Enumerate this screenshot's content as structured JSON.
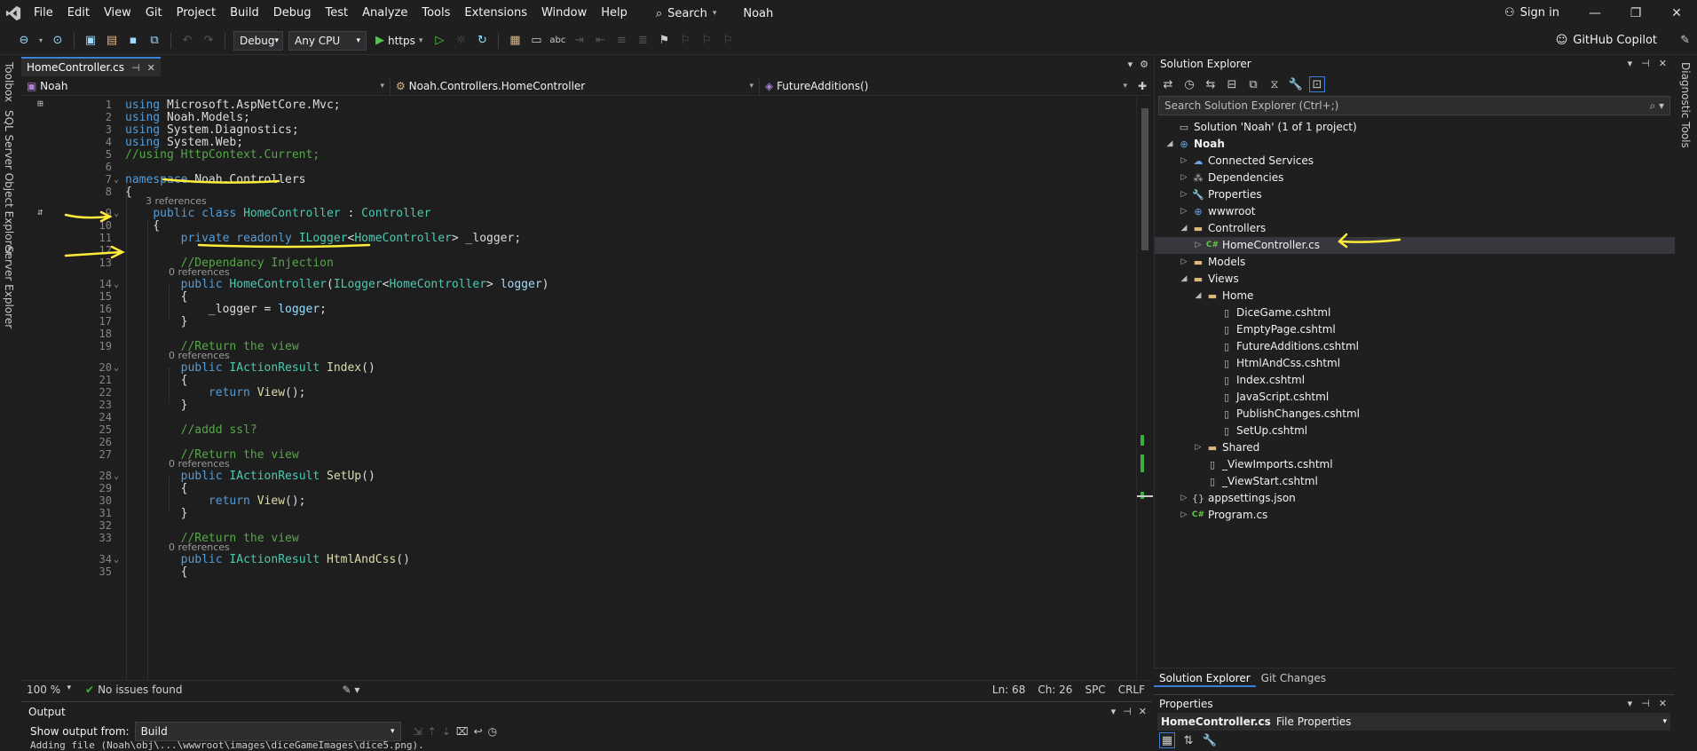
{
  "menu": {
    "items": [
      "File",
      "Edit",
      "View",
      "Git",
      "Project",
      "Build",
      "Debug",
      "Test",
      "Analyze",
      "Tools",
      "Extensions",
      "Window",
      "Help"
    ],
    "search_label": "Search",
    "solution_name": "Noah",
    "sign_in": "Sign in"
  },
  "toolbar": {
    "config": "Debug",
    "platform": "Any CPU",
    "run_label": "https",
    "copilot": "GitHub Copilot"
  },
  "left_rail": [
    "Toolbox",
    "SQL Server Object Explorer",
    "Server Explorer"
  ],
  "right_rail": [
    "Diagnostic Tools"
  ],
  "editor": {
    "tab_name": "HomeController.cs",
    "nav_project": "Noah",
    "nav_class": "Noah.Controllers.HomeController",
    "nav_member": "FutureAdditions()",
    "lines": [
      {
        "n": "1",
        "t": [
          [
            "kw",
            "using"
          ],
          [
            "nm",
            " Microsoft.AspNetCore.Mvc;"
          ]
        ]
      },
      {
        "n": "2",
        "t": [
          [
            "kw",
            "using"
          ],
          [
            "nm",
            " Noah.Models;"
          ]
        ]
      },
      {
        "n": "3",
        "t": [
          [
            "kw",
            "using"
          ],
          [
            "nm",
            " System.Diagnostics;"
          ]
        ]
      },
      {
        "n": "4",
        "t": [
          [
            "kw",
            "using"
          ],
          [
            "nm",
            " System.Web;"
          ]
        ]
      },
      {
        "n": "5",
        "t": [
          [
            "cm",
            "//using HttpContext.Current;"
          ]
        ]
      },
      {
        "n": "6",
        "t": []
      },
      {
        "n": "7",
        "t": [
          [
            "kw",
            "namespace"
          ],
          [
            "nm",
            " Noah.Controllers"
          ]
        ]
      },
      {
        "n": "8",
        "t": [
          [
            "nm",
            "{"
          ]
        ]
      },
      {
        "n": "9",
        "t": [
          [
            "nm",
            "    "
          ],
          [
            "kw",
            "public class"
          ],
          [
            "nm",
            " "
          ],
          [
            "ty",
            "HomeController"
          ],
          [
            "nm",
            " : "
          ],
          [
            "ty",
            "Controller"
          ]
        ]
      },
      {
        "n": "10",
        "t": [
          [
            "nm",
            "    {"
          ]
        ]
      },
      {
        "n": "11",
        "t": [
          [
            "nm",
            "        "
          ],
          [
            "kw",
            "private readonly"
          ],
          [
            "nm",
            " "
          ],
          [
            "ty",
            "ILogger"
          ],
          [
            "nm",
            "<"
          ],
          [
            "ty",
            "HomeController"
          ],
          [
            "nm",
            "> _logger;"
          ]
        ]
      },
      {
        "n": "12",
        "t": []
      },
      {
        "n": "13",
        "t": [
          [
            "nm",
            "        "
          ],
          [
            "cm",
            "//Dependancy Injection"
          ]
        ]
      },
      {
        "n": "14",
        "t": [
          [
            "nm",
            "        "
          ],
          [
            "kw",
            "public"
          ],
          [
            "nm",
            " "
          ],
          [
            "ty",
            "HomeController"
          ],
          [
            "nm",
            "("
          ],
          [
            "ty",
            "ILogger"
          ],
          [
            "nm",
            "<"
          ],
          [
            "ty",
            "HomeController"
          ],
          [
            "nm",
            "> "
          ],
          [
            "pr",
            "logger"
          ],
          [
            "nm",
            ")"
          ]
        ]
      },
      {
        "n": "15",
        "t": [
          [
            "nm",
            "        {"
          ]
        ]
      },
      {
        "n": "16",
        "t": [
          [
            "nm",
            "            _logger = "
          ],
          [
            "pr",
            "logger"
          ],
          [
            "nm",
            ";"
          ]
        ]
      },
      {
        "n": "17",
        "t": [
          [
            "nm",
            "        }"
          ]
        ]
      },
      {
        "n": "18",
        "t": []
      },
      {
        "n": "19",
        "t": [
          [
            "nm",
            "        "
          ],
          [
            "cm",
            "//Return the view"
          ]
        ]
      },
      {
        "n": "20",
        "t": [
          [
            "nm",
            "        "
          ],
          [
            "kw",
            "public"
          ],
          [
            "nm",
            " "
          ],
          [
            "ty",
            "IActionResult"
          ],
          [
            "nm",
            " "
          ],
          [
            "fn",
            "Index"
          ],
          [
            "nm",
            "()"
          ]
        ]
      },
      {
        "n": "21",
        "t": [
          [
            "nm",
            "        {"
          ]
        ]
      },
      {
        "n": "22",
        "t": [
          [
            "nm",
            "            "
          ],
          [
            "kw",
            "return"
          ],
          [
            "nm",
            " "
          ],
          [
            "fn",
            "View"
          ],
          [
            "nm",
            "();"
          ]
        ]
      },
      {
        "n": "23",
        "t": [
          [
            "nm",
            "        }"
          ]
        ]
      },
      {
        "n": "24",
        "t": []
      },
      {
        "n": "25",
        "t": [
          [
            "nm",
            "        "
          ],
          [
            "cm",
            "//addd ssl?"
          ]
        ]
      },
      {
        "n": "26",
        "t": []
      },
      {
        "n": "27",
        "t": [
          [
            "nm",
            "        "
          ],
          [
            "cm",
            "//Return the view"
          ]
        ]
      },
      {
        "n": "28",
        "t": [
          [
            "nm",
            "        "
          ],
          [
            "kw",
            "public"
          ],
          [
            "nm",
            " "
          ],
          [
            "ty",
            "IActionResult"
          ],
          [
            "nm",
            " "
          ],
          [
            "fn",
            "SetUp"
          ],
          [
            "nm",
            "()"
          ]
        ]
      },
      {
        "n": "29",
        "t": [
          [
            "nm",
            "        {"
          ]
        ]
      },
      {
        "n": "30",
        "t": [
          [
            "nm",
            "            "
          ],
          [
            "kw",
            "return"
          ],
          [
            "nm",
            " "
          ],
          [
            "fn",
            "View"
          ],
          [
            "nm",
            "();"
          ]
        ]
      },
      {
        "n": "31",
        "t": [
          [
            "nm",
            "        }"
          ]
        ]
      },
      {
        "n": "32",
        "t": []
      },
      {
        "n": "33",
        "t": [
          [
            "nm",
            "        "
          ],
          [
            "cm",
            "//Return the view"
          ]
        ]
      },
      {
        "n": "34",
        "t": [
          [
            "nm",
            "        "
          ],
          [
            "kw",
            "public"
          ],
          [
            "nm",
            " "
          ],
          [
            "ty",
            "IActionResult"
          ],
          [
            "nm",
            " "
          ],
          [
            "fn",
            "HtmlAndCss"
          ],
          [
            "nm",
            "()"
          ]
        ]
      },
      {
        "n": "35",
        "t": [
          [
            "nm",
            "        {"
          ]
        ]
      }
    ],
    "refs_3": "3 references",
    "refs_0": "0 references",
    "status_zoom": "100 %",
    "status_issues": "No issues found",
    "status_ln": "Ln: 68",
    "status_ch": "Ch: 26",
    "status_spc": "SPC",
    "status_crlf": "CRLF"
  },
  "output": {
    "title": "Output",
    "show_from_label": "Show output from:",
    "source": "Build",
    "text": "Adding file (Noah\\obj\\...\\wwwroot\\images\\diceGameImages\\dice5.png)."
  },
  "solution_explorer": {
    "title": "Solution Explorer",
    "search_placeholder": "Search Solution Explorer (Ctrl+;)",
    "tree": [
      {
        "label": "Solution 'Noah' (1 of 1 project)",
        "icon": "solution-icon",
        "exp": "",
        "level": 0
      },
      {
        "label": "Noah",
        "icon": "project-icon",
        "exp": "◢",
        "level": 0,
        "bold": true
      },
      {
        "label": "Connected Services",
        "icon": "cloud-icon",
        "exp": "▷",
        "level": 1
      },
      {
        "label": "Dependencies",
        "icon": "dependencies-icon",
        "exp": "▷",
        "level": 1
      },
      {
        "label": "Properties",
        "icon": "properties-icon",
        "exp": "▷",
        "level": 1
      },
      {
        "label": "wwwroot",
        "icon": "globe-icon",
        "exp": "▷",
        "level": 1
      },
      {
        "label": "Controllers",
        "icon": "folder-icon",
        "exp": "◢",
        "level": 1
      },
      {
        "label": "HomeController.cs",
        "icon": "csharp-file-icon",
        "exp": "▷",
        "level": 2,
        "selected": true
      },
      {
        "label": "Models",
        "icon": "folder-icon",
        "exp": "▷",
        "level": 1
      },
      {
        "label": "Views",
        "icon": "folder-icon",
        "exp": "◢",
        "level": 1
      },
      {
        "label": "Home",
        "icon": "folder-icon",
        "exp": "◢",
        "level": 2
      },
      {
        "label": "DiceGame.cshtml",
        "icon": "cshtml-file-icon",
        "exp": "",
        "level": 3
      },
      {
        "label": "EmptyPage.cshtml",
        "icon": "cshtml-file-icon",
        "exp": "",
        "level": 3
      },
      {
        "label": "FutureAdditions.cshtml",
        "icon": "cshtml-file-icon",
        "exp": "",
        "level": 3
      },
      {
        "label": "HtmlAndCss.cshtml",
        "icon": "cshtml-file-icon",
        "exp": "",
        "level": 3
      },
      {
        "label": "Index.cshtml",
        "icon": "cshtml-file-icon",
        "exp": "",
        "level": 3
      },
      {
        "label": "JavaScript.cshtml",
        "icon": "cshtml-file-icon",
        "exp": "",
        "level": 3
      },
      {
        "label": "PublishChanges.cshtml",
        "icon": "cshtml-file-icon",
        "exp": "",
        "level": 3
      },
      {
        "label": "SetUp.cshtml",
        "icon": "cshtml-file-icon",
        "exp": "",
        "level": 3
      },
      {
        "label": "Shared",
        "icon": "folder-icon",
        "exp": "▷",
        "level": 2
      },
      {
        "label": "_ViewImports.cshtml",
        "icon": "cshtml-file-icon",
        "exp": "",
        "level": 2
      },
      {
        "label": "_ViewStart.cshtml",
        "icon": "cshtml-file-icon",
        "exp": "",
        "level": 2
      },
      {
        "label": "appsettings.json",
        "icon": "json-file-icon",
        "exp": "▷",
        "level": 1
      },
      {
        "label": "Program.cs",
        "icon": "csharp-file-icon",
        "exp": "▷",
        "level": 1
      }
    ],
    "tabs": [
      "Solution Explorer",
      "Git Changes"
    ]
  },
  "properties": {
    "title": "Properties",
    "object_name": "HomeController.cs",
    "object_type": "File Properties"
  },
  "colors": {
    "accent": "#3b7fd6",
    "annotation": "#ffeb3b",
    "ok": "#3ab03a"
  }
}
